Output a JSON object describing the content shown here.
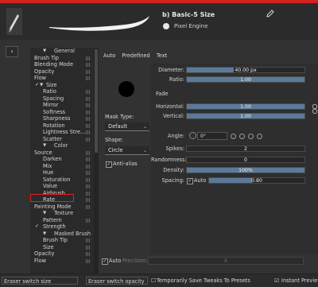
{
  "header": {
    "preset_name": "b) Basic-5 Size",
    "engine_label": "Pixel Engine",
    "accent_color": "#d4221f"
  },
  "tree": {
    "items": [
      {
        "label": "General",
        "kind": "section"
      },
      {
        "label": "Brush Tip"
      },
      {
        "label": "Blending Mode"
      },
      {
        "label": "Opacity"
      },
      {
        "label": "Flow"
      },
      {
        "label": "Size",
        "checked": true,
        "arrow": true
      },
      {
        "label": "Ratio",
        "indent": true
      },
      {
        "label": "Spacing",
        "indent": true
      },
      {
        "label": "Mirror",
        "indent": true
      },
      {
        "label": "Softness",
        "indent": true
      },
      {
        "label": "Sharpness",
        "indent": true
      },
      {
        "label": "Rotation",
        "indent": true
      },
      {
        "label": "Lightness Stre...",
        "indent": true
      },
      {
        "label": "Scatter",
        "indent": true
      },
      {
        "label": "Color",
        "kind": "section"
      },
      {
        "label": "Source"
      },
      {
        "label": "Darken",
        "indent": true
      },
      {
        "label": "Mix",
        "indent": true
      },
      {
        "label": "Hue",
        "indent": true
      },
      {
        "label": "Saturation",
        "indent": true
      },
      {
        "label": "Value",
        "indent": true
      },
      {
        "label": "Airbrush",
        "indent": true
      },
      {
        "label": "Rate",
        "indent": true
      },
      {
        "label": "Painting Mode"
      },
      {
        "label": "Texture",
        "kind": "section"
      },
      {
        "label": "Pattern",
        "indent": true
      },
      {
        "label": "Strength",
        "checked": true
      },
      {
        "label": "Masked Brush",
        "kind": "section"
      },
      {
        "label": "Brush Tip",
        "indent": true
      },
      {
        "label": "Size",
        "indent": true
      },
      {
        "label": "Opacity"
      },
      {
        "label": "Flow"
      }
    ]
  },
  "tabs": {
    "auto": "Auto",
    "predefined": "Predefined",
    "text": "Text"
  },
  "tip": {
    "mask_type_label": "Mask Type:",
    "mask_type_value": "Default",
    "shape_label": "Shape:",
    "shape_value": "Circle",
    "anti_alias_label": "Anti-alias"
  },
  "params": {
    "diameter_label": "Diameter:",
    "diameter_value": "40.00 px",
    "diameter_fill": 0.4,
    "ratio_label": "Ratio:",
    "ratio_value": "1.00",
    "ratio_fill": 1.0,
    "fade_label": "Fade",
    "horizontal_label": "Horizontal:",
    "horizontal_value": "1.00",
    "horizontal_fill": 1.0,
    "vertical_label": "Vertical:",
    "vertical_value": "1.00",
    "vertical_fill": 1.0,
    "angle_label": "Angle:",
    "angle_value": "0°",
    "spikes_label": "Spikes:",
    "spikes_value": "2",
    "spikes_fill": 0.0,
    "randomness_label": "Randomness:",
    "randomness_value": "0",
    "randomness_fill": 0.0,
    "density_label": "Density:",
    "density_value": "100%",
    "density_fill": 1.0,
    "spacing_label": "Spacing:",
    "spacing_auto": "Auto",
    "spacing_value": "0.80",
    "spacing_fill": 0.45
  },
  "precision": {
    "auto_label": "Auto",
    "precision_label": "Precision:",
    "precision_value": "5"
  },
  "bottom": {
    "eraser_size": "Eraser switch size",
    "eraser_opacity": "Eraser switch opacity",
    "temp_save": "Temporarily Save Tweaks To Presets",
    "instant_preview": "Instant Preview"
  }
}
